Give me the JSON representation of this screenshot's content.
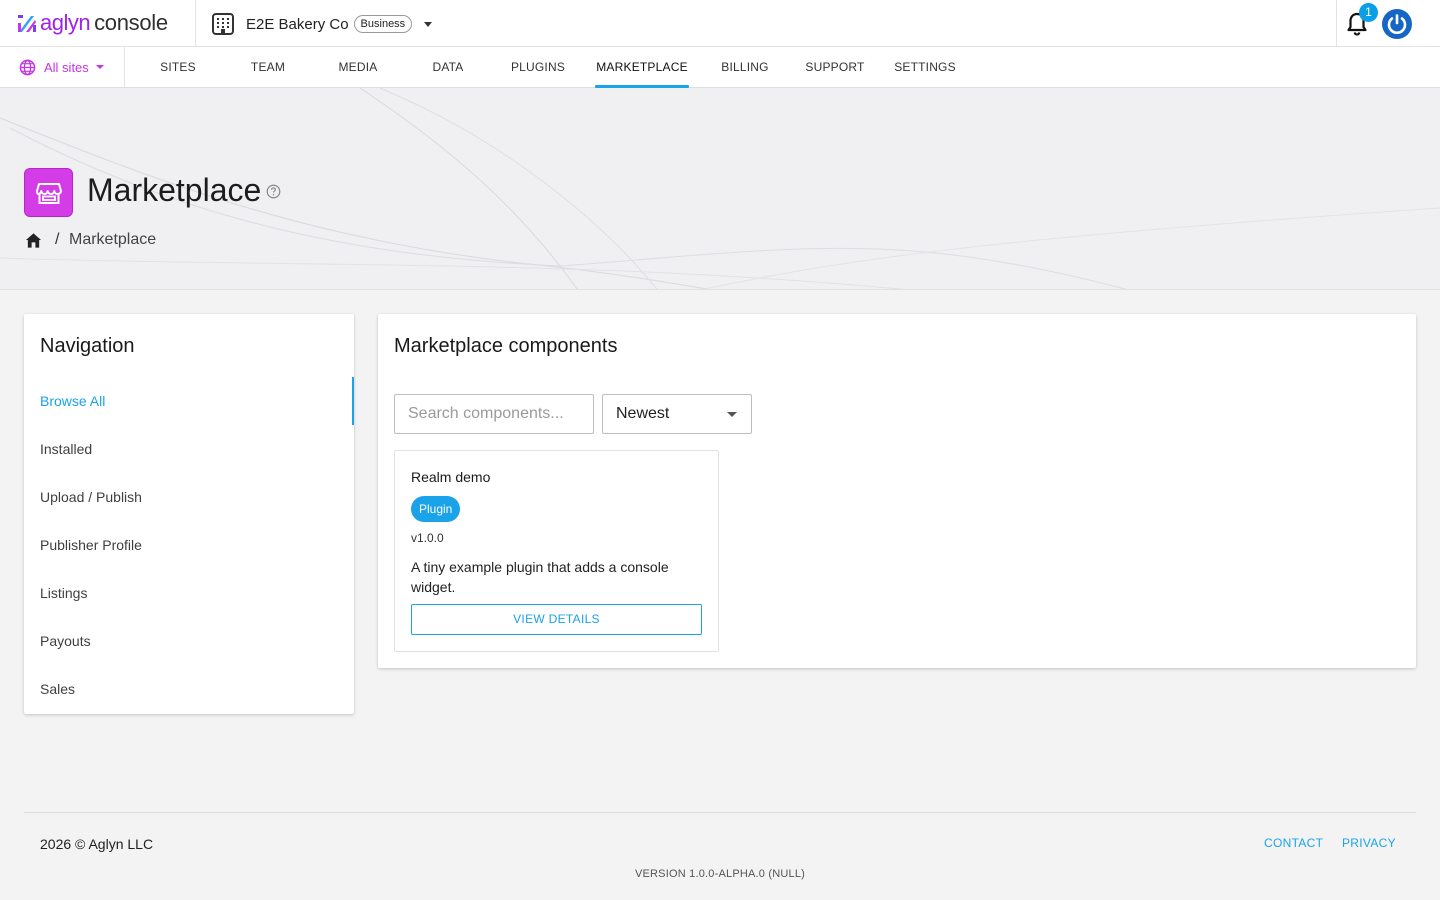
{
  "header": {
    "brand_prefix": "aglyn",
    "brand_suffix": "console",
    "org_name": "E2E Bakery Co",
    "org_badge": "Business",
    "notification_count": "1"
  },
  "nav": {
    "sites_selector": "All sites",
    "tabs": [
      {
        "label": "SITES"
      },
      {
        "label": "TEAM"
      },
      {
        "label": "MEDIA"
      },
      {
        "label": "DATA"
      },
      {
        "label": "PLUGINS"
      },
      {
        "label": "MARKETPLACE",
        "active": true
      },
      {
        "label": "BILLING"
      },
      {
        "label": "SUPPORT"
      },
      {
        "label": "SETTINGS"
      }
    ]
  },
  "hero": {
    "title": "Marketplace",
    "breadcrumb_current": "Marketplace",
    "breadcrumb_separator": "/"
  },
  "sidebar": {
    "title": "Navigation",
    "items": [
      {
        "label": "Browse All",
        "active": true
      },
      {
        "label": "Installed"
      },
      {
        "label": "Upload / Publish"
      },
      {
        "label": "Publisher Profile"
      },
      {
        "label": "Listings"
      },
      {
        "label": "Payouts"
      },
      {
        "label": "Sales"
      }
    ]
  },
  "main": {
    "title": "Marketplace components",
    "search_placeholder": "Search components...",
    "sort_value": "Newest",
    "components": [
      {
        "name": "Realm demo",
        "type": "Plugin",
        "version": "v1.0.0",
        "description": "A tiny example plugin that adds a console widget.",
        "action": "VIEW DETAILS"
      }
    ]
  },
  "footer": {
    "copyright": "2026 © Aglyn LLC",
    "contact": "CONTACT",
    "privacy": "PRIVACY",
    "version": "VERSION 1.0.0-ALPHA.0 (NULL)"
  },
  "colors": {
    "accent": "#1aa3e8",
    "brand_purple": "#a020f0",
    "marketplace_icon": "#d33ce6",
    "power_button": "#1666c5"
  },
  "icons": {
    "logo": "aglyn-logo-icon",
    "org": "building-icon",
    "notifications": "bell-icon",
    "account": "power-icon",
    "sites": "globe-icon",
    "marketplace": "storefront-icon",
    "help": "help-circle-icon",
    "home": "home-icon"
  }
}
